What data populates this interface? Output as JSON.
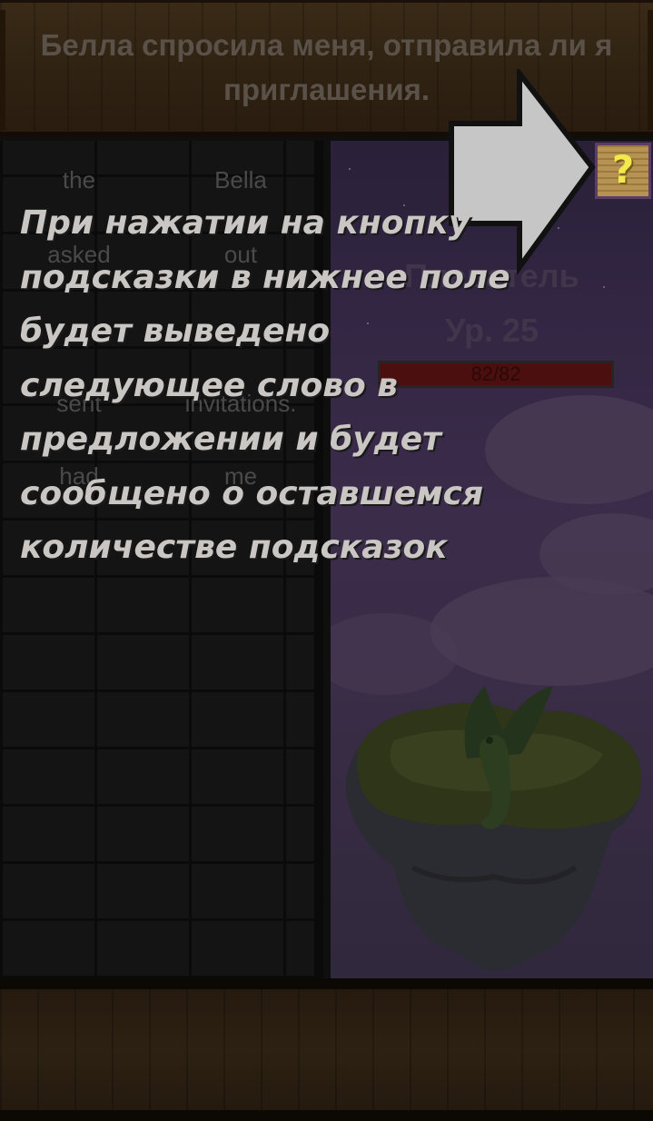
{
  "sentence": {
    "text": "Белла спросила меня, отправила ли я приглашения."
  },
  "word_tiles": [
    "the",
    "Bella",
    "asked",
    "out",
    "sent",
    "invitations.",
    "had",
    "me"
  ],
  "monster": {
    "name": "Плеватель",
    "level": "Ур. 25",
    "hp_text": "82/82",
    "hp_fraction": 1.0
  },
  "hint_button": {
    "label": "?"
  },
  "tutorial": {
    "text": "При нажатии на кнопку подсказки в нижнее поле будет выведено следующее слово в предложении и будет сообщено о оставшемся количестве подсказок"
  },
  "colors": {
    "overlay_text": "#c9c6c3",
    "hp_bar": "#4c0f0f",
    "help_icon": "#f2e94a"
  }
}
